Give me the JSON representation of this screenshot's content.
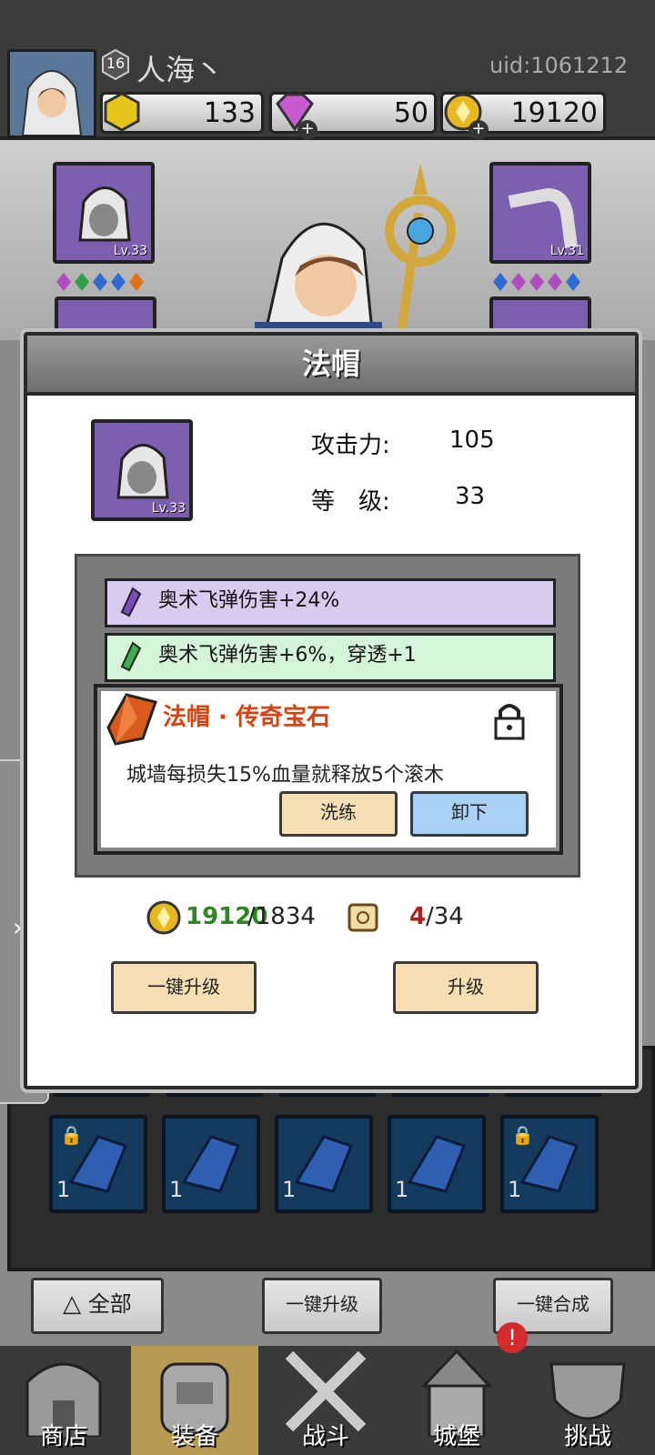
{
  "player": {
    "level": "16",
    "name": "人海丶",
    "uid": "uid:1061212"
  },
  "resources": {
    "energy": "133",
    "gems": "50",
    "gold": "19120",
    "plus": "+"
  },
  "equipment": {
    "left_top_level": "Lv.33",
    "right_top_level": "Lv.31"
  },
  "modal": {
    "title": "法帽",
    "item_level": "Lv.33",
    "attack_label": "攻击力:",
    "attack_value": "105",
    "level_label": "等　级:",
    "level_value": "33",
    "gem_rows": [
      {
        "text": "奥术飞弹伤害+24%",
        "color": "#d7ccf0"
      },
      {
        "text": "奥术飞弹伤害+6%，穿透+1",
        "color": "#d5f5d8"
      }
    ],
    "legend": {
      "title": "法帽 · 传奇宝石",
      "description": "城墙每损失15%血量就释放5个滚木",
      "reroll_label": "洗练",
      "unequip_label": "卸下"
    },
    "cost": {
      "gold_have": "19120",
      "gold_need": "/1834",
      "scroll_have": "4",
      "scroll_need": "/34"
    },
    "upgrade_all_label": "一键升级",
    "upgrade_label": "升级"
  },
  "inventory": {
    "count": "1"
  },
  "controls": {
    "filter_label": "全部",
    "upgrade_all_label": "一键升级",
    "merge_all_label": "一键合成"
  },
  "nav": {
    "shop": "商店",
    "equipment": "装备",
    "battle": "战斗",
    "castle": "城堡",
    "challenge": "挑战",
    "alert": "!"
  },
  "colors": {
    "accent_purple": "#7d5fb1",
    "gold": "#d9a400",
    "button_cream": "#f7dfb4",
    "button_blue": "#a9d1f7"
  }
}
